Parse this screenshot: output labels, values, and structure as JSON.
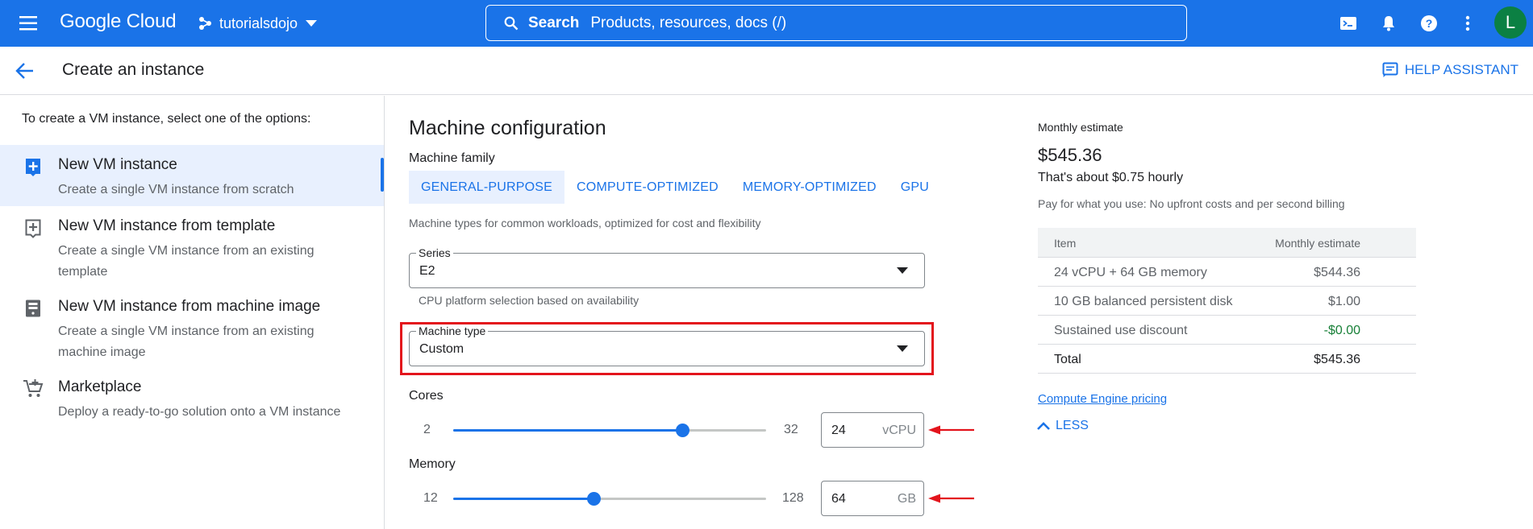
{
  "topbar": {
    "logo": "Google Cloud",
    "project": "tutorialsdojo",
    "search_label": "Search",
    "search_placeholder": "Products, resources, docs (/)",
    "avatar_initial": "L"
  },
  "header": {
    "title": "Create an instance",
    "help": "HELP ASSISTANT"
  },
  "left": {
    "intro": "To create a VM instance, select one of the options:",
    "options": [
      {
        "title": "New VM instance",
        "desc": "Create a single VM instance from scratch"
      },
      {
        "title": "New VM instance from template",
        "desc": "Create a single VM instance from an existing template"
      },
      {
        "title": "New VM instance from machine image",
        "desc": "Create a single VM instance from an existing machine image"
      },
      {
        "title": "Marketplace",
        "desc": "Deploy a ready-to-go solution onto a VM instance"
      }
    ]
  },
  "machine": {
    "heading": "Machine configuration",
    "family_label": "Machine family",
    "tabs": [
      "GENERAL-PURPOSE",
      "COMPUTE-OPTIMIZED",
      "MEMORY-OPTIMIZED",
      "GPU"
    ],
    "family_hint": "Machine types for common workloads, optimized for cost and flexibility",
    "series_label": "Series",
    "series_value": "E2",
    "series_hint": "CPU platform selection based on availability",
    "type_label": "Machine type",
    "type_value": "Custom",
    "cores": {
      "label": "Cores",
      "min": "2",
      "max": "32",
      "value": "24",
      "unit": "vCPU",
      "fraction": 0.733
    },
    "memory": {
      "label": "Memory",
      "min": "12",
      "max": "128",
      "value": "64",
      "unit": "GB",
      "fraction": 0.448
    }
  },
  "estimate": {
    "label": "Monthly estimate",
    "amount": "$545.36",
    "hourly": "That's about $0.75 hourly",
    "pay_note": "Pay for what you use: No upfront costs and per second billing",
    "col_item": "Item",
    "col_estimate": "Monthly estimate",
    "rows": [
      {
        "item": "24 vCPU + 64 GB memory",
        "value": "$544.36"
      },
      {
        "item": "10 GB balanced persistent disk",
        "value": "$1.00"
      },
      {
        "item": "Sustained use discount",
        "value": "-$0.00"
      },
      {
        "item": "Total",
        "value": "$545.36"
      }
    ],
    "pricing_link": "Compute Engine pricing",
    "less": "LESS"
  },
  "colors": {
    "brand": "#1a73e8",
    "highlight": "#e3141c",
    "discount": "#188038",
    "avatar": "#0b8043"
  }
}
